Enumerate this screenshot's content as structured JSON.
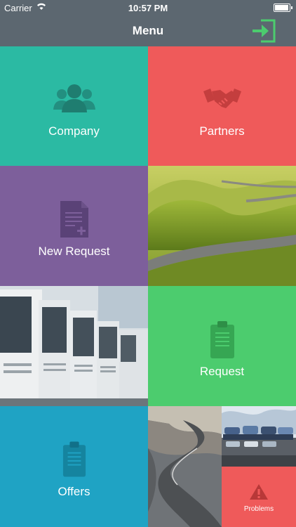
{
  "status_bar": {
    "carrier": "Carrier",
    "time": "10:57 PM"
  },
  "nav": {
    "title": "Menu",
    "login_icon": "sign-in-icon"
  },
  "tiles": {
    "company": {
      "label": "Company",
      "color": "#2bbaa3",
      "icon": "users-icon"
    },
    "partners": {
      "label": "Partners",
      "color": "#ef5a5a",
      "icon": "handshake-icon"
    },
    "new_request": {
      "label": "New Request",
      "color": "#7d5f9b",
      "icon": "document-add-icon"
    },
    "request": {
      "label": "Request",
      "color": "#4ccc6e",
      "icon": "clipboard-icon"
    },
    "offers": {
      "label": "Offers",
      "color": "#1fa3c4",
      "icon": "clipboard-icon"
    },
    "problems": {
      "label": "Problems",
      "color": "#ef5a5a",
      "icon": "warning-icon"
    }
  },
  "colors": {
    "navbar": "#5c6770",
    "login_icon": "#4ccc6e"
  }
}
